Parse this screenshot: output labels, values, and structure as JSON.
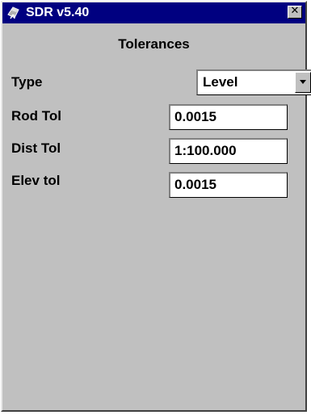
{
  "window": {
    "title": "SDR v5.40",
    "close_glyph": "✕",
    "icon": "app-icon"
  },
  "form": {
    "heading": "Tolerances",
    "type": {
      "label": "Type",
      "value": "Level"
    },
    "rod_tol": {
      "label": "Rod Tol",
      "value": "0.0015"
    },
    "dist_tol": {
      "label": "Dist Tol",
      "value": "1:100.000"
    },
    "elev_tol": {
      "label": "Elev tol",
      "value": "0.0015"
    }
  },
  "colors": {
    "titlebar": "#000080",
    "face": "#c0c0c0",
    "field": "#ffffff"
  }
}
